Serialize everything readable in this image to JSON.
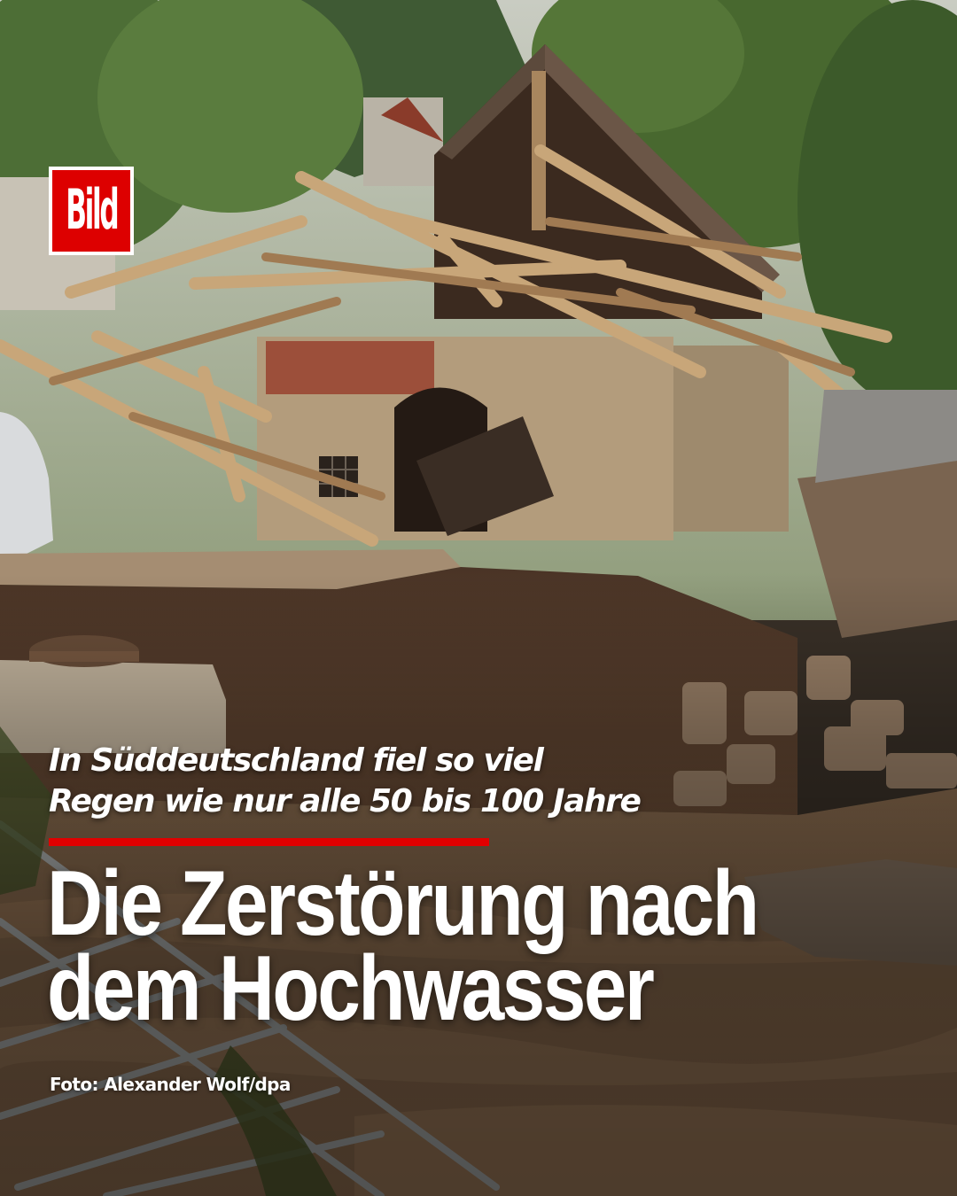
{
  "brand": {
    "logo_text": "Bild",
    "logo_color": "#dd0000"
  },
  "post": {
    "kicker_line1": "In Süddeutschland fiel so viel",
    "kicker_line2": "Regen wie nur alle 50 bis 100 Jahre",
    "headline_line1": "Die Zerstörung nach",
    "headline_line2": "dem Hochwasser",
    "photo_credit": "Foto: Alexander Wolf/dpa",
    "accent_color": "#e00000"
  }
}
